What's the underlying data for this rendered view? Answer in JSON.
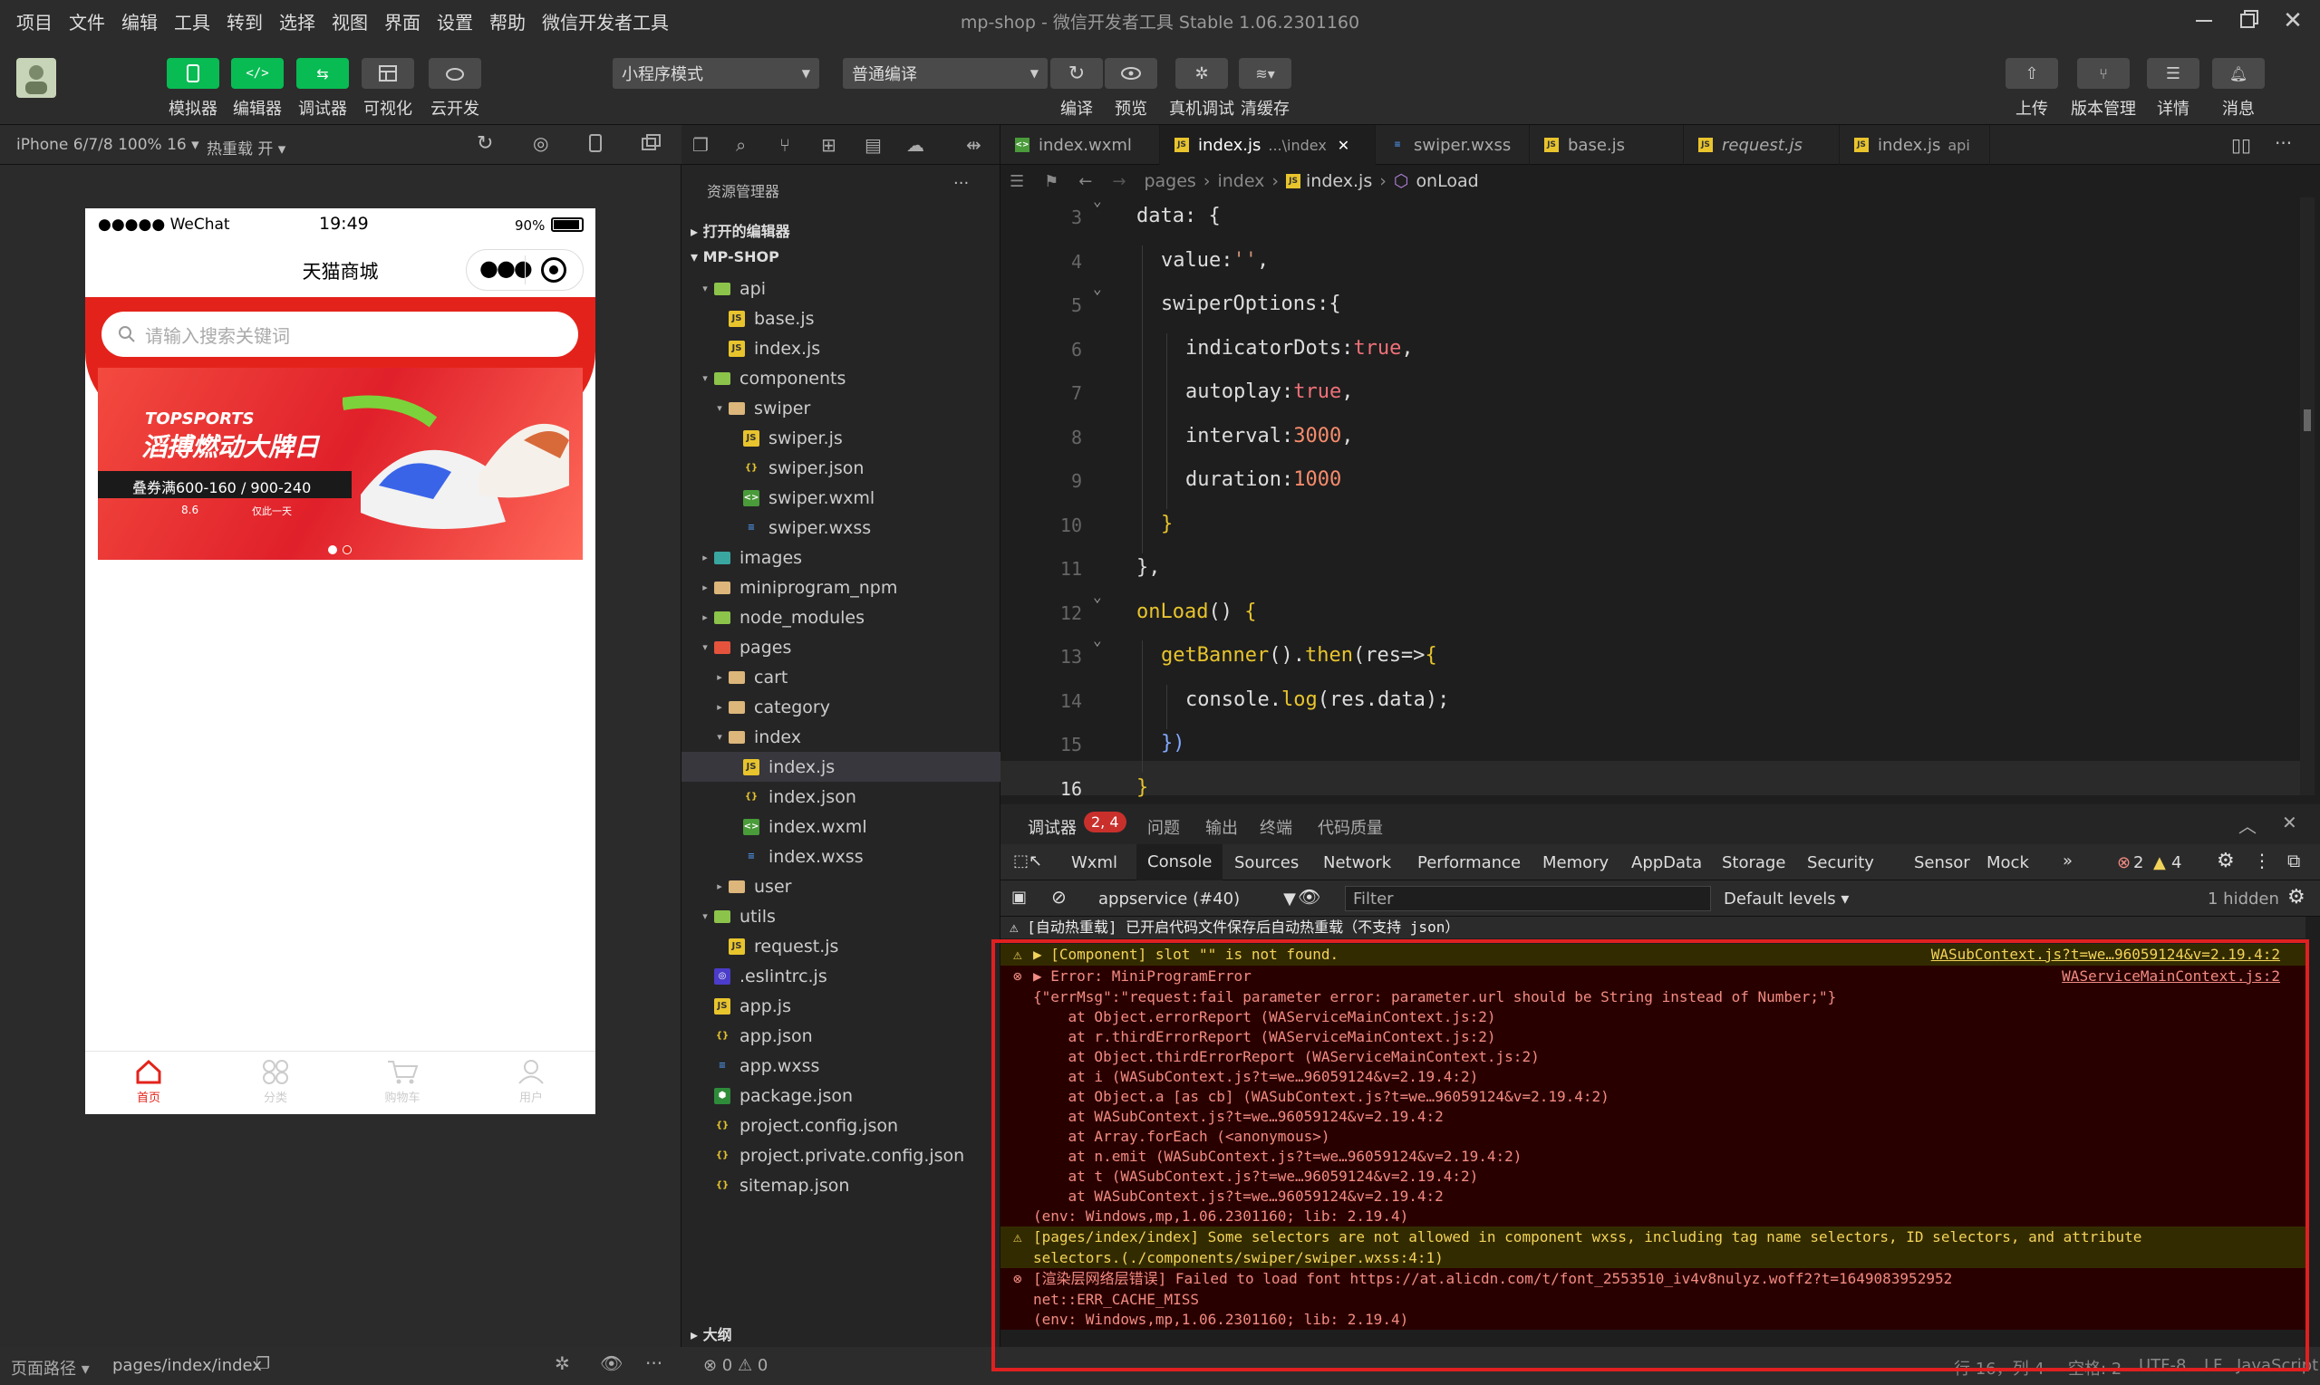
{
  "menubar": {
    "items": [
      "项目",
      "文件",
      "编辑",
      "工具",
      "转到",
      "选择",
      "视图",
      "界面",
      "设置",
      "帮助",
      "微信开发者工具"
    ],
    "title": "mp-shop - 微信开发者工具 Stable 1.06.2301160"
  },
  "toolbar": {
    "simulator": "模拟器",
    "editor": "编辑器",
    "debugger": "调试器",
    "visual": "可视化",
    "cloud": "云开发",
    "mode": "小程序模式",
    "compile_mode": "普通编译",
    "compile": "编译",
    "preview": "预览",
    "remote_debug": "真机调试",
    "clear_cache": "清缓存",
    "upload": "上传",
    "version": "版本管理",
    "details": "详情",
    "messages": "消息"
  },
  "simbar": {
    "device": "iPhone 6/7/8 100% 16",
    "hotreload": "热重载 开"
  },
  "phone": {
    "carrier": "●●●●● WeChat",
    "time": "19:49",
    "battery": "90%",
    "nav_title": "天猫商城",
    "search_placeholder": "请输入搜索关键词",
    "banner_brand": "TOPSPORTS",
    "banner_title": "滔搏燃动大牌日",
    "banner_promo": "叠券满600-160 / 900-240",
    "banner_date": "8.6",
    "banner_note": "仅此一天",
    "tabs": [
      "首页",
      "分类",
      "购物车",
      "用户"
    ]
  },
  "explorer": {
    "title": "资源管理器",
    "open_editors": "打开的编辑器",
    "project": "MP-SHOP",
    "outline": "大纲",
    "status": "⊗ 0 ⚠ 0",
    "tree": [
      {
        "label": "api",
        "type": "folder",
        "depth": 1,
        "open": true
      },
      {
        "label": "base.js",
        "type": "js",
        "depth": 2
      },
      {
        "label": "index.js",
        "type": "js",
        "depth": 2
      },
      {
        "label": "components",
        "type": "folder",
        "depth": 1,
        "open": true
      },
      {
        "label": "swiper",
        "type": "folder",
        "depth": 2,
        "open": true
      },
      {
        "label": "swiper.js",
        "type": "js",
        "depth": 3
      },
      {
        "label": "swiper.json",
        "type": "json",
        "depth": 3
      },
      {
        "label": "swiper.wxml",
        "type": "wxml",
        "depth": 3
      },
      {
        "label": "swiper.wxss",
        "type": "wxss",
        "depth": 3
      },
      {
        "label": "images",
        "type": "folder",
        "depth": 1,
        "open": false
      },
      {
        "label": "miniprogram_npm",
        "type": "folder",
        "depth": 1,
        "open": false
      },
      {
        "label": "node_modules",
        "type": "folder",
        "depth": 1,
        "open": false
      },
      {
        "label": "pages",
        "type": "folder",
        "depth": 1,
        "open": true
      },
      {
        "label": "cart",
        "type": "folder",
        "depth": 2,
        "open": false
      },
      {
        "label": "category",
        "type": "folder",
        "depth": 2,
        "open": false
      },
      {
        "label": "index",
        "type": "folder",
        "depth": 2,
        "open": true
      },
      {
        "label": "index.js",
        "type": "js",
        "depth": 3,
        "selected": true
      },
      {
        "label": "index.json",
        "type": "json",
        "depth": 3
      },
      {
        "label": "index.wxml",
        "type": "wxml",
        "depth": 3
      },
      {
        "label": "index.wxss",
        "type": "wxss",
        "depth": 3
      },
      {
        "label": "user",
        "type": "folder",
        "depth": 2,
        "open": false
      },
      {
        "label": "utils",
        "type": "folder",
        "depth": 1,
        "open": true
      },
      {
        "label": "request.js",
        "type": "js",
        "depth": 2
      },
      {
        "label": ".eslintrc.js",
        "type": "eslint",
        "depth": 1
      },
      {
        "label": "app.js",
        "type": "js",
        "depth": 1
      },
      {
        "label": "app.json",
        "type": "json",
        "depth": 1
      },
      {
        "label": "app.wxss",
        "type": "wxss",
        "depth": 1
      },
      {
        "label": "package.json",
        "type": "pkg",
        "depth": 1
      },
      {
        "label": "project.config.json",
        "type": "json",
        "depth": 1
      },
      {
        "label": "project.private.config.json",
        "type": "json",
        "depth": 1
      },
      {
        "label": "sitemap.json",
        "type": "json",
        "depth": 1
      }
    ]
  },
  "editor": {
    "tabs": [
      {
        "label": "index.wxml",
        "icon": "wxml"
      },
      {
        "label": "index.js",
        "suffix": "...\\index",
        "icon": "js",
        "active": true
      },
      {
        "label": "swiper.wxss",
        "icon": "wxss"
      },
      {
        "label": "base.js",
        "icon": "js"
      },
      {
        "label": "request.js",
        "icon": "js",
        "italic": true
      },
      {
        "label": "index.js",
        "suffix": "api",
        "icon": "js"
      }
    ],
    "breadcrumb": [
      "pages",
      "index",
      "index.js",
      "onLoad"
    ],
    "lines": [
      {
        "n": "3",
        "indent": 0,
        "tokens": [
          [
            "data: {",
            "p"
          ]
        ]
      },
      {
        "n": "4",
        "indent": 1,
        "tokens": [
          [
            "value:",
            "p"
          ],
          [
            "''",
            "st"
          ],
          [
            ",",
            "p"
          ]
        ]
      },
      {
        "n": "5",
        "indent": 1,
        "tokens": [
          [
            "swiperOptions:{",
            "p"
          ]
        ]
      },
      {
        "n": "6",
        "indent": 2,
        "tokens": [
          [
            "indicatorDots:",
            "p"
          ],
          [
            "true",
            "bo"
          ],
          [
            ",",
            "p"
          ]
        ]
      },
      {
        "n": "7",
        "indent": 2,
        "tokens": [
          [
            "autoplay:",
            "p"
          ],
          [
            "true",
            "bo"
          ],
          [
            ",",
            "p"
          ]
        ]
      },
      {
        "n": "8",
        "indent": 2,
        "tokens": [
          [
            "interval:",
            "p"
          ],
          [
            "3000",
            "nu"
          ],
          [
            ",",
            "p"
          ]
        ]
      },
      {
        "n": "9",
        "indent": 2,
        "tokens": [
          [
            "duration:",
            "p"
          ],
          [
            "1000",
            "nu"
          ]
        ]
      },
      {
        "n": "10",
        "indent": 1,
        "tokens": [
          [
            "}",
            "kw"
          ]
        ]
      },
      {
        "n": "11",
        "indent": 0,
        "tokens": [
          [
            "},",
            "p"
          ]
        ]
      },
      {
        "n": "12",
        "indent": 0,
        "tokens": [
          [
            "onLoad",
            "fn"
          ],
          [
            "() ",
            "p"
          ],
          [
            "{",
            "kw"
          ]
        ]
      },
      {
        "n": "13",
        "indent": 1,
        "tokens": [
          [
            "getBanner",
            "fn"
          ],
          [
            "().",
            "p"
          ],
          [
            "then",
            "fn"
          ],
          [
            "(res=>",
            "p"
          ],
          [
            "{",
            "kw"
          ]
        ]
      },
      {
        "n": "14",
        "indent": 2,
        "tokens": [
          [
            "console.",
            "p"
          ],
          [
            "log",
            "fn"
          ],
          [
            "(res.data);",
            "p"
          ]
        ]
      },
      {
        "n": "15",
        "indent": 1,
        "tokens": [
          [
            "})",
            "pu"
          ]
        ]
      },
      {
        "n": "16",
        "indent": 0,
        "tokens": [
          [
            "}",
            "kw"
          ]
        ]
      }
    ]
  },
  "devtools": {
    "title": "调试器",
    "badge": "2, 4",
    "header_tabs": [
      "问题",
      "输出",
      "终端",
      "代码质量"
    ],
    "tabs": [
      "Wxml",
      "Console",
      "Sources",
      "Network",
      "Performance",
      "Memory",
      "AppData",
      "Storage",
      "Security",
      "Sensor",
      "Mock"
    ],
    "errors": "2",
    "warnings": "4",
    "context": "appservice (#40)",
    "filter_placeholder": "Filter",
    "levels": "Default levels",
    "hidden": "1 hidden",
    "lines": [
      {
        "kind": "info",
        "text": "⚠ [自动热重载] 已开启代码文件保存后自动热重载（不支持 json）"
      },
      {
        "kind": "warn",
        "text": "▶ [Component] slot \"\" is not found.",
        "src": "WASubContext.js?t=we…96059124&v=2.19.4:2"
      },
      {
        "kind": "err",
        "text": "▶ Error: MiniProgramError",
        "src": "WAServiceMainContext.js:2"
      },
      {
        "kind": "errc",
        "text": "{\"errMsg\":\"request:fail parameter error: parameter.url should be String instead of Number;\"}"
      },
      {
        "kind": "errc",
        "text": "    at Object.errorReport (WAServiceMainContext.js:2)"
      },
      {
        "kind": "errc",
        "text": "    at r.thirdErrorReport (WAServiceMainContext.js:2)"
      },
      {
        "kind": "errc",
        "text": "    at Object.thirdErrorReport (WAServiceMainContext.js:2)"
      },
      {
        "kind": "errc",
        "text": "    at i (WASubContext.js?t=we…96059124&v=2.19.4:2)"
      },
      {
        "kind": "errc",
        "text": "    at Object.a [as cb] (WASubContext.js?t=we…96059124&v=2.19.4:2)"
      },
      {
        "kind": "errc",
        "text": "    at WASubContext.js?t=we…96059124&v=2.19.4:2"
      },
      {
        "kind": "errc",
        "text": "    at Array.forEach (<anonymous>)"
      },
      {
        "kind": "errc",
        "text": "    at n.emit (WASubContext.js?t=we…96059124&v=2.19.4:2)"
      },
      {
        "kind": "errc",
        "text": "    at t (WASubContext.js?t=we…96059124&v=2.19.4:2)"
      },
      {
        "kind": "errc",
        "text": "    at WASubContext.js?t=we…96059124&v=2.19.4:2"
      },
      {
        "kind": "errc",
        "text": "(env: Windows,mp,1.06.2301160; lib: 2.19.4)"
      },
      {
        "kind": "warn2",
        "text": "[pages/index/index] Some selectors are not allowed in component wxss, including tag name selectors, ID selectors, and attribute"
      },
      {
        "kind": "warnc",
        "text": "selectors.(./components/swiper/swiper.wxss:4:1)"
      },
      {
        "kind": "err",
        "text": "[渲染层网络层错误] Failed to load font https://at.alicdn.com/t/font_2553510_iv4v8nulyz.woff2?t=1649083952952"
      },
      {
        "kind": "errc",
        "text": "net::ERR_CACHE_MISS"
      },
      {
        "kind": "errc",
        "text": "(env: Windows,mp,1.06.2301160; lib: 2.19.4)"
      }
    ]
  },
  "statusbar": {
    "path_label": "页面路径",
    "path": "pages/index/index",
    "cursor": "行 16，列 4",
    "spaces": "空格: 2",
    "encoding": "UTF-8",
    "eol": "LF",
    "lang": "JavaScript"
  }
}
